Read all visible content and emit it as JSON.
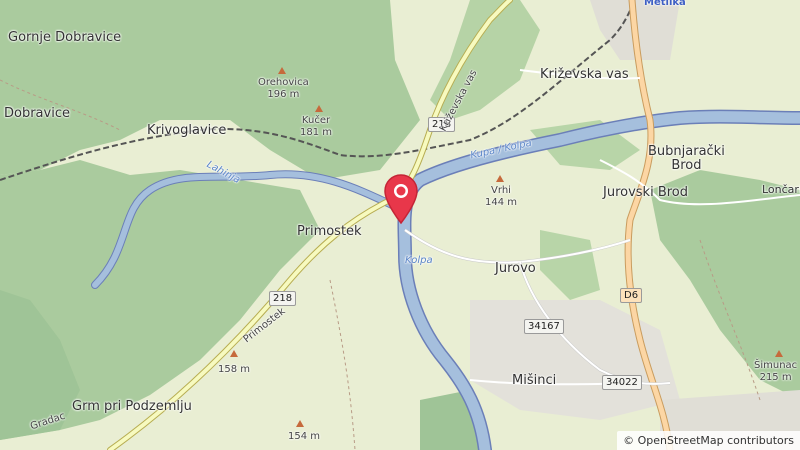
{
  "map": {
    "places": {
      "gornje_dobravice": "Gornje Dobravice",
      "dobravice": "Dobravice",
      "krivoglavice": "Krivoglavice",
      "primostek": "Primostek",
      "krizevska_vas": "Križevska vas",
      "bubnjaracki_brod": "Bubnjarački\nBrod",
      "jurovski_brod": "Jurovski Brod",
      "loncaric": "Lončarić",
      "jurovo": "Jurovo",
      "misinci": "Mišinci",
      "grm_pri_podzemlju": "Grm pri Podzemlju",
      "metlika": "Metlika",
      "gradac": "Gradac"
    },
    "peaks": {
      "orehovica": "Orehovica\n196 m",
      "kucer": "Kučer\n181 m",
      "vrhi": "Vrhi\n144 m",
      "simunac": "Šimunac\n215 m",
      "p158": "158 m",
      "p154": "154 m"
    },
    "water": {
      "lahinja": "Lahinja",
      "kupa_kolpa": "Kupa / Kolpa",
      "kolpa": "Kolpa"
    },
    "roads": {
      "r218_north": "218",
      "r218_south": "218",
      "d6": "D6",
      "r34167": "34167",
      "r34022": "34022",
      "street_krizevska": "Križevska vas",
      "street_primostek": "Primostek"
    },
    "attribution": "© OpenStreetMap contributors",
    "colors": {
      "forest": "#aacb9e",
      "farmland": "#eef0d5",
      "river": "#a5bfdd",
      "river_border": "#6b7fb8",
      "road": "#f7fabf",
      "road_border": "#b7ad52",
      "major_road": "#fcd6a4",
      "railway": "#555555",
      "marker": "#e8374a"
    }
  }
}
